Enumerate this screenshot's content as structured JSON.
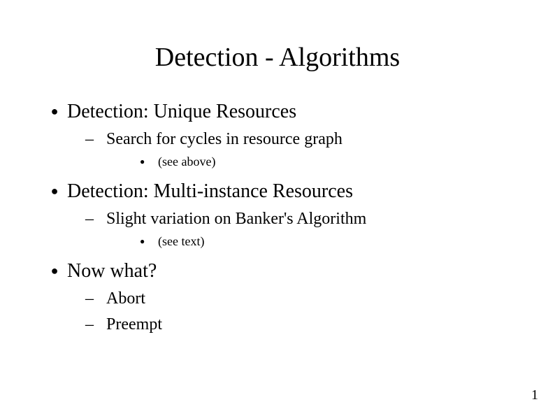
{
  "slide": {
    "title": "Detection - Algorithms",
    "page_number": "1",
    "items": [
      {
        "text": "Detection: Unique Resources",
        "sub": [
          {
            "text": "Search for cycles in resource graph",
            "sub": [
              {
                "text": "(see above)"
              }
            ]
          }
        ]
      },
      {
        "text": "Detection: Multi-instance Resources",
        "sub": [
          {
            "text": "Slight variation on Banker's Algorithm",
            "sub": [
              {
                "text": "(see text)"
              }
            ]
          }
        ]
      },
      {
        "text": "Now what?",
        "sub": [
          {
            "text": "Abort"
          },
          {
            "text": "Preempt"
          }
        ]
      }
    ]
  }
}
